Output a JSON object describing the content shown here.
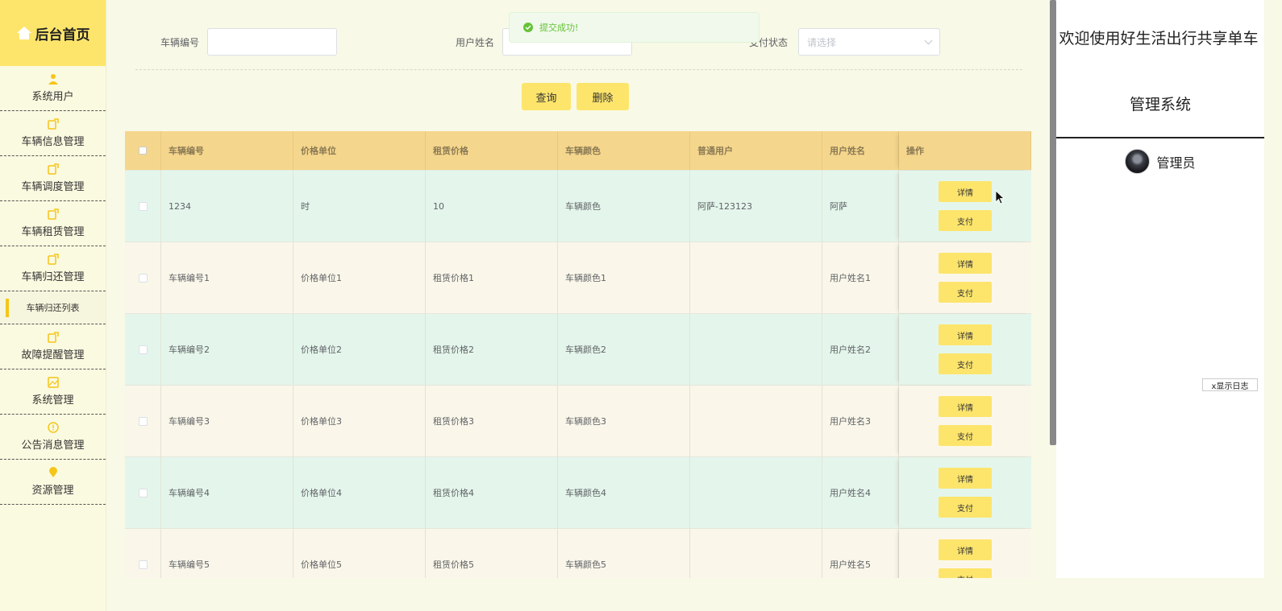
{
  "sidebar": {
    "home_label": "后台首页",
    "items": [
      {
        "label": "系统用户",
        "icon": "user-icon"
      },
      {
        "label": "车辆信息管理",
        "icon": "edit-icon"
      },
      {
        "label": "车辆调度管理",
        "icon": "edit-icon"
      },
      {
        "label": "车辆租赁管理",
        "icon": "edit-icon"
      },
      {
        "label": "车辆归还管理",
        "icon": "edit-icon"
      }
    ],
    "sub_item": {
      "label": "车辆归还列表"
    },
    "items_after": [
      {
        "label": "故障提醒管理",
        "icon": "edit-icon"
      },
      {
        "label": "系统管理",
        "icon": "image-icon"
      },
      {
        "label": "公告消息管理",
        "icon": "warning-icon"
      },
      {
        "label": "资源管理",
        "icon": "location-icon"
      }
    ]
  },
  "toast": {
    "message": "提交成功!"
  },
  "search": {
    "vehicle_no_label": "车辆编号",
    "vehicle_no_value": "",
    "user_name_label": "用户姓名",
    "user_name_value": "",
    "pay_status_label": "支付状态",
    "pay_status_placeholder": "请选择"
  },
  "buttons": {
    "query": "查询",
    "delete": "删除"
  },
  "table": {
    "headers": [
      "车辆编号",
      "价格单位",
      "租赁价格",
      "车辆颜色",
      "普通用户",
      "用户姓名",
      "操作"
    ],
    "detail_label": "详情",
    "pay_label": "支付",
    "rows": [
      [
        "1234",
        "时",
        "10",
        "车辆颜色",
        "阿萨-123123",
        "阿萨"
      ],
      [
        "车辆编号1",
        "价格单位1",
        "租赁价格1",
        "车辆颜色1",
        "",
        "用户姓名1"
      ],
      [
        "车辆编号2",
        "价格单位2",
        "租赁价格2",
        "车辆颜色2",
        "",
        "用户姓名2"
      ],
      [
        "车辆编号3",
        "价格单位3",
        "租赁价格3",
        "车辆颜色3",
        "",
        "用户姓名3"
      ],
      [
        "车辆编号4",
        "价格单位4",
        "租赁价格4",
        "车辆颜色4",
        "",
        "用户姓名4"
      ],
      [
        "车辆编号5",
        "价格单位5",
        "租赁价格5",
        "车辆颜色5",
        "",
        "用户姓名5"
      ]
    ]
  },
  "right_panel": {
    "welcome_line1": "欢迎使用好生活出行共享单车",
    "welcome_line2": "管理系统",
    "admin_name": "管理员",
    "log_button": "x显示日志"
  },
  "colors": {
    "accent": "#fde56c",
    "header": "#f5d68d",
    "row_green": "#e4f6ec",
    "row_cream": "#faf7ea"
  }
}
